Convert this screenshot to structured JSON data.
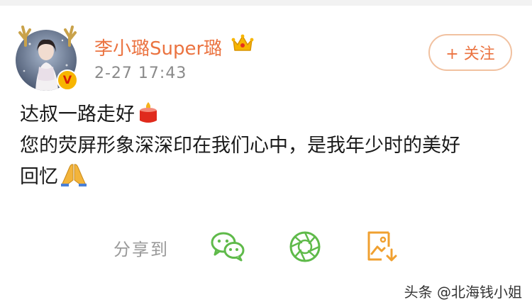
{
  "post": {
    "author": {
      "name": "李小璐Super璐",
      "verified_badge": "V",
      "avatar_icon": "avatar-photo",
      "crown_icon": "vip-crown-icon"
    },
    "timestamp": "2-27 17:43",
    "follow_button": "+ 关注",
    "text_lines": {
      "line1": "达叔一路走好",
      "line2": "您的荧屏形象深深印在我们心中，是我年少时的美好",
      "line3": "回忆"
    },
    "emojis": [
      "candle-emoji",
      "praying-hands-emoji"
    ]
  },
  "share": {
    "label": "分享到",
    "targets": [
      "wechat-icon",
      "moments-icon",
      "save-image-icon"
    ]
  },
  "watermark": "头条 @北海钱小姐",
  "colors": {
    "username": "#eb7340",
    "follow_border": "#f1c1a0",
    "timestamp": "#8a8a8a",
    "share_green": "#5fba4a",
    "save_orange": "#f0a030"
  }
}
